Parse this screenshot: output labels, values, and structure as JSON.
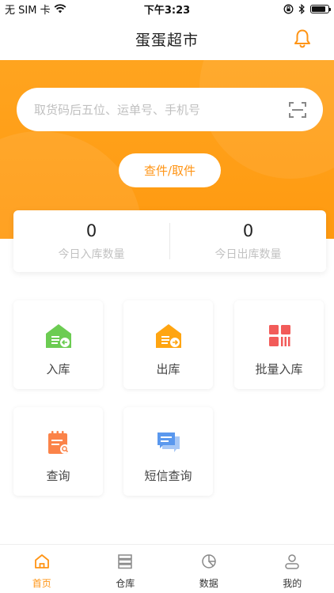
{
  "status_bar": {
    "carrier": "无 SIM 卡",
    "time": "下午3:23",
    "battery_level": 0.85
  },
  "nav": {
    "title": "蛋蛋超市",
    "bell_icon": "bell-icon"
  },
  "search": {
    "placeholder": "取货码后五位、运单号、手机号",
    "scan_icon": "scan-icon"
  },
  "actions": {
    "query_pickup": "查件/取件"
  },
  "stats": [
    {
      "value": "0",
      "label": "今日入库数量"
    },
    {
      "value": "0",
      "label": "今日出库数量"
    }
  ],
  "functions": [
    {
      "label": "入库",
      "icon": "warehouse-in-icon",
      "color": "#6ccc52"
    },
    {
      "label": "出库",
      "icon": "warehouse-out-icon",
      "color": "#ffa511"
    },
    {
      "label": "批量入库",
      "icon": "batch-in-icon",
      "color": "#f25b59"
    },
    {
      "label": "查询",
      "icon": "calendar-search-icon",
      "color": "#fb8349"
    },
    {
      "label": "短信查询",
      "icon": "sms-icon",
      "color": "#5a98ee"
    }
  ],
  "tabs": [
    {
      "label": "首页",
      "icon": "home-icon",
      "active": true
    },
    {
      "label": "仓库",
      "icon": "warehouse-icon",
      "active": false
    },
    {
      "label": "数据",
      "icon": "chart-pie-icon",
      "active": false
    },
    {
      "label": "我的",
      "icon": "profile-icon",
      "active": false
    }
  ],
  "colors": {
    "accent": "#ff9414",
    "hero": "#ffa41f"
  }
}
